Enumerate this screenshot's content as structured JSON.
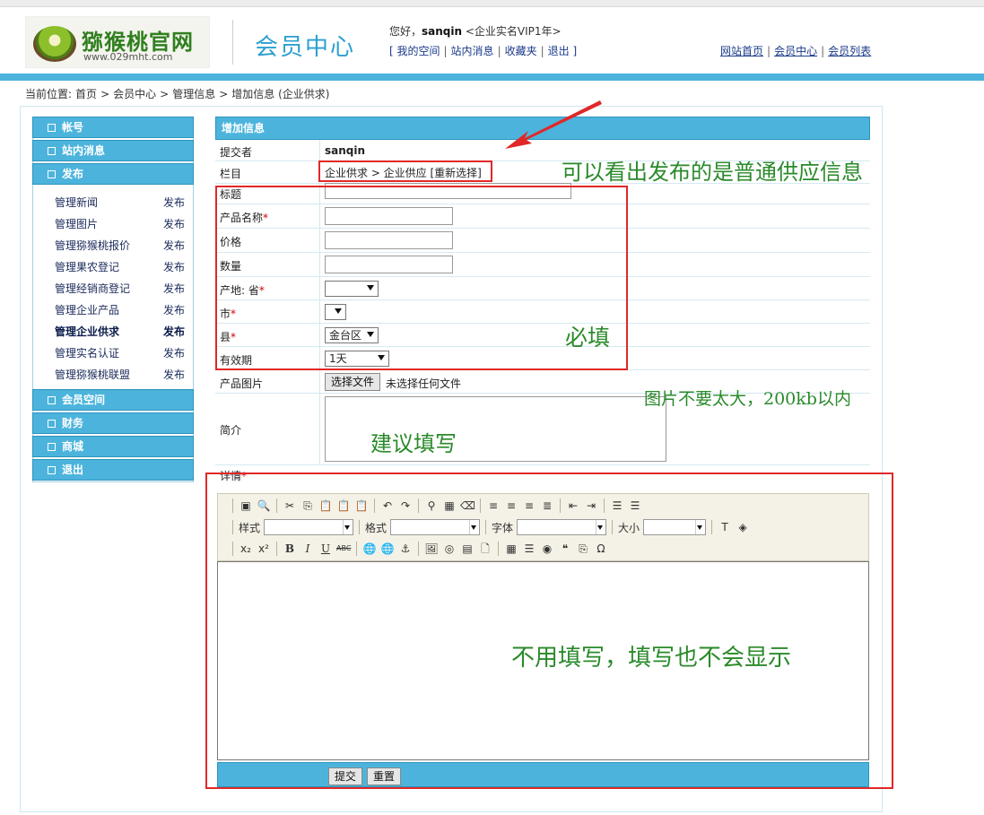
{
  "header": {
    "logo_title": "猕猴桃官网",
    "logo_url": "www.029mht.com",
    "member_center": "会员中心",
    "greeting_prefix": "您好，",
    "username": "sanqin",
    "vip_text": " <企业实名VIP1年>",
    "quick_links": [
      "[ 我的空间",
      "站内消息",
      "收藏夹",
      "退出 ]"
    ],
    "site_links": [
      "网站首页",
      "会员中心",
      "会员列表"
    ],
    "link_sep": "|"
  },
  "breadcrumb": {
    "prefix": "当前位置:",
    "items": [
      "首页",
      ">",
      "会员中心",
      ">",
      "管理信息",
      ">",
      "增加信息 (企业供求)"
    ]
  },
  "sidebar": {
    "sections": [
      {
        "label": "帐号"
      },
      {
        "label": "站内消息"
      },
      {
        "label": "发布"
      },
      {
        "label": "会员空间"
      },
      {
        "label": "财务"
      },
      {
        "label": "商城"
      },
      {
        "label": "退出"
      }
    ],
    "publish_items": [
      {
        "name": "管理新闻",
        "action": "发布"
      },
      {
        "name": "管理图片",
        "action": "发布"
      },
      {
        "name": "管理猕猴桃报价",
        "action": "发布"
      },
      {
        "name": "管理果农登记",
        "action": "发布"
      },
      {
        "name": "管理经销商登记",
        "action": "发布"
      },
      {
        "name": "管理企业产品",
        "action": "发布"
      },
      {
        "name": "管理企业供求",
        "action": "发布"
      },
      {
        "name": "管理实名认证",
        "action": "发布"
      },
      {
        "name": "管理猕猴桃联盟",
        "action": "发布"
      }
    ]
  },
  "form": {
    "title": "增加信息",
    "submitter_label": "提交者",
    "submitter_value": "sanqin",
    "column_label": "栏目",
    "column_value": "企业供求 > 企业供应 [重新选择]",
    "title_label": "标题",
    "product_name_label": "产品名称",
    "price_label": "价格",
    "quantity_label": "数量",
    "origin_label": "产地: 省",
    "city_label": "市",
    "county_label": "县",
    "county_value": "金台区",
    "validity_label": "有效期",
    "validity_value": "1天",
    "image_label": "产品图片",
    "file_button": "选择文件",
    "file_status": "未选择任何文件",
    "intro_label": "简介",
    "detail_label": "详情",
    "required_mark": "*",
    "submit_button": "提交",
    "reset_button": "重置"
  },
  "editor": {
    "style_label": "样式",
    "format_label": "格式",
    "font_label": "字体",
    "size_label": "大小"
  },
  "annotations": {
    "column_note": "可以看出发布的是普通供应信息",
    "required_note": "必填",
    "image_note": "图片不要太大，200kb以内",
    "intro_note": "建议填写",
    "detail_note": "不用填写，填写也不会显示"
  },
  "colors": {
    "accent_blue": "#4cb4dc",
    "annotation_red": "#e02828",
    "annotation_green": "#2a8a2a"
  }
}
